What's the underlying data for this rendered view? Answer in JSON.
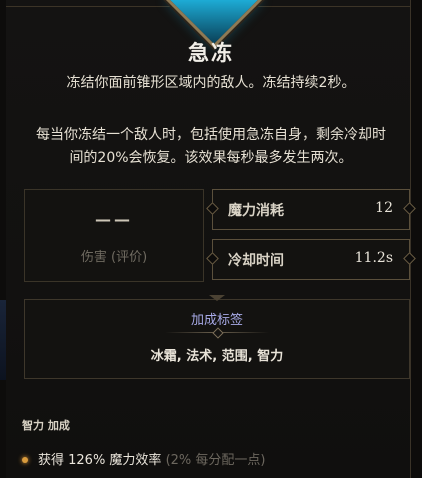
{
  "skill": {
    "title": "急冻",
    "desc1": "冻结你面前锥形区域内的敌人。冻结持续2秒。",
    "desc2_line1": "每当你冻结一个敌人时，包括使用急冻自身，剩余冷却时",
    "desc2_line2": "间的20%会恢复。该效果每秒最多发生两次。"
  },
  "damage": {
    "value": "——",
    "label": "伤害 (评价)"
  },
  "stats": [
    {
      "label": "魔力消耗",
      "value": "12"
    },
    {
      "label": "冷却时间",
      "value": "11.2s"
    }
  ],
  "tags": {
    "title": "加成标签",
    "list": "冰霜, 法术, 范围, 智力"
  },
  "bonus": {
    "title": "智力 加成",
    "main": "获得 126% 魔力效率",
    "extra": "(2% 每分配一点)"
  },
  "colors": {
    "accent_tag": "#a7a9e6",
    "bullet": "#d99b3d",
    "gem": "#1fb6e2"
  }
}
